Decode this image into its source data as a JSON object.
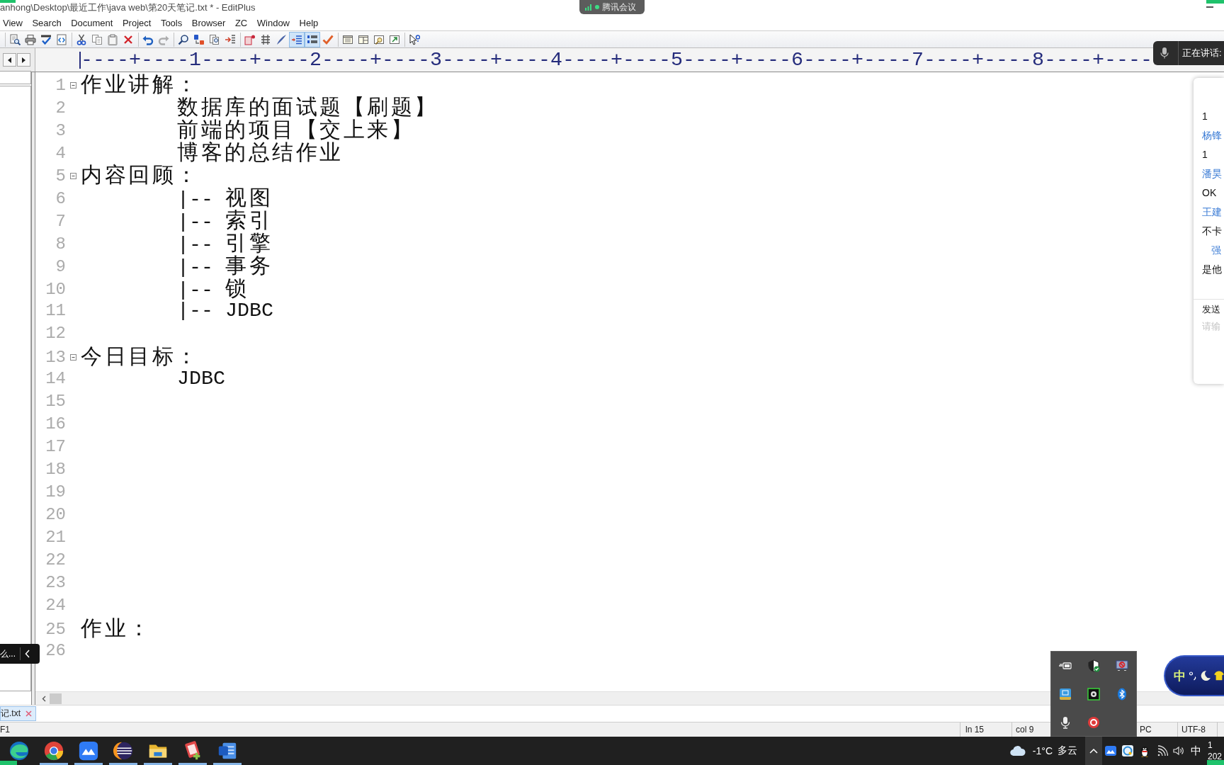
{
  "window": {
    "title": "anhong\\Desktop\\最近工作\\java web\\第20天笔记.txt * - EditPlus"
  },
  "meeting_tab": {
    "label": "腾讯会议"
  },
  "menu": [
    "View",
    "Search",
    "Document",
    "Project",
    "Tools",
    "Browser",
    "ZC",
    "Window",
    "Help"
  ],
  "toolbar": [
    [
      {
        "kind": "button",
        "disabled": false
      },
      {
        "kind": "button",
        "disabled": false
      },
      {
        "kind": "button",
        "disabled": false
      },
      {
        "kind": "button",
        "disabled": false
      }
    ],
    [
      {
        "kind": "button",
        "disabled": false
      },
      {
        "kind": "button",
        "disabled": false
      },
      {
        "kind": "button",
        "disabled": false
      },
      {
        "kind": "button",
        "disabled": false
      }
    ],
    [
      {
        "kind": "button",
        "disabled": false
      },
      {
        "kind": "button",
        "disabled": true
      }
    ],
    [
      {
        "kind": "button",
        "disabled": false
      },
      {
        "kind": "button",
        "disabled": false
      },
      {
        "kind": "button",
        "disabled": false
      },
      {
        "kind": "button",
        "disabled": false
      }
    ],
    [
      {
        "kind": "toggle",
        "pressed": false,
        "disabled": false
      },
      {
        "kind": "toggle",
        "pressed": false,
        "disabled": false
      },
      {
        "kind": "toggle",
        "pressed": false,
        "disabled": false
      },
      {
        "kind": "toggle",
        "pressed": true,
        "disabled": false
      },
      {
        "kind": "toggle",
        "pressed": true,
        "disabled": false
      },
      {
        "kind": "button",
        "disabled": false
      }
    ],
    [
      {
        "kind": "button",
        "disabled": false
      },
      {
        "kind": "button",
        "disabled": false
      },
      {
        "kind": "button",
        "disabled": false
      },
      {
        "kind": "button",
        "disabled": false
      }
    ],
    [
      {
        "kind": "button",
        "disabled": false
      }
    ]
  ],
  "ruler": {
    "text": "----+----1----+----2----+----3----+----4----+----5----+----6----+----7----+----8----+----"
  },
  "speaking_indicator": {
    "label": "正在讲话:"
  },
  "editor": {
    "lines": [
      {
        "number": "1",
        "text": "作业讲解：",
        "expanded": true,
        "children": [
          {
            "number": "2",
            "text": "数据库的面试题【刷题】"
          },
          {
            "number": "3",
            "text": "前端的项目【交上来】"
          },
          {
            "number": "4",
            "text": "博客的总结作业"
          }
        ]
      },
      {
        "number": "5",
        "text": "内容回顾：",
        "expanded": true,
        "children": [
          {
            "number": "6",
            "text": "|-- 视图"
          },
          {
            "number": "7",
            "text": "|-- 索引"
          },
          {
            "number": "8",
            "text": "|-- 引擎"
          },
          {
            "number": "9",
            "text": "|-- 事务"
          },
          {
            "number": "10",
            "text": "|-- 锁"
          },
          {
            "number": "11",
            "text": "|-- JDBC"
          }
        ]
      },
      {
        "number": "12"
      },
      {
        "number": "13",
        "text": "今日目标：",
        "expanded": true,
        "children": [
          {
            "number": "14",
            "text": "JDBC"
          }
        ]
      },
      {
        "number": "15"
      },
      {
        "number": "16"
      },
      {
        "number": "17"
      },
      {
        "number": "18"
      },
      {
        "number": "19"
      },
      {
        "number": "20"
      },
      {
        "number": "21"
      },
      {
        "number": "22"
      },
      {
        "number": "23"
      },
      {
        "number": "24"
      },
      {
        "number": "25",
        "text": "作业："
      },
      {
        "number": "26"
      }
    ]
  },
  "chat_panel": {
    "messages": [
      {
        "kind": "text",
        "text": "1"
      },
      {
        "kind": "name",
        "text": "杨锋"
      },
      {
        "kind": "text",
        "text": "1"
      },
      {
        "kind": "name",
        "text": "潘昊"
      },
      {
        "kind": "text",
        "text": "OK"
      },
      {
        "kind": "name",
        "text": "王建"
      },
      {
        "kind": "text",
        "text": "不卡"
      },
      {
        "kind": "mention",
        "text": "强"
      },
      {
        "kind": "text",
        "text": "是他"
      }
    ],
    "send_to": "发送",
    "input": {
      "placeholder": "请输"
    }
  },
  "side_tooltip": {
    "text": "么..."
  },
  "document_tabs": [
    {
      "label": "记.txt",
      "selected": true
    }
  ],
  "status_bar": {
    "hint": "F1",
    "line": "ln 15",
    "column": "col 9",
    "line_ending": "PC",
    "encoding": "UTF-8"
  },
  "ime_bar": {
    "mode": "中"
  },
  "taskbar": {
    "apps": [
      {
        "running": false
      },
      {
        "running": true
      },
      {
        "running": true
      },
      {
        "running": true
      },
      {
        "running": true
      },
      {
        "running": true
      },
      {
        "running": true
      }
    ],
    "weather": {
      "temperature": "-1°C",
      "condition": "多云"
    },
    "input_method": "中",
    "clock": {
      "time": "1",
      "date": "202"
    }
  }
}
